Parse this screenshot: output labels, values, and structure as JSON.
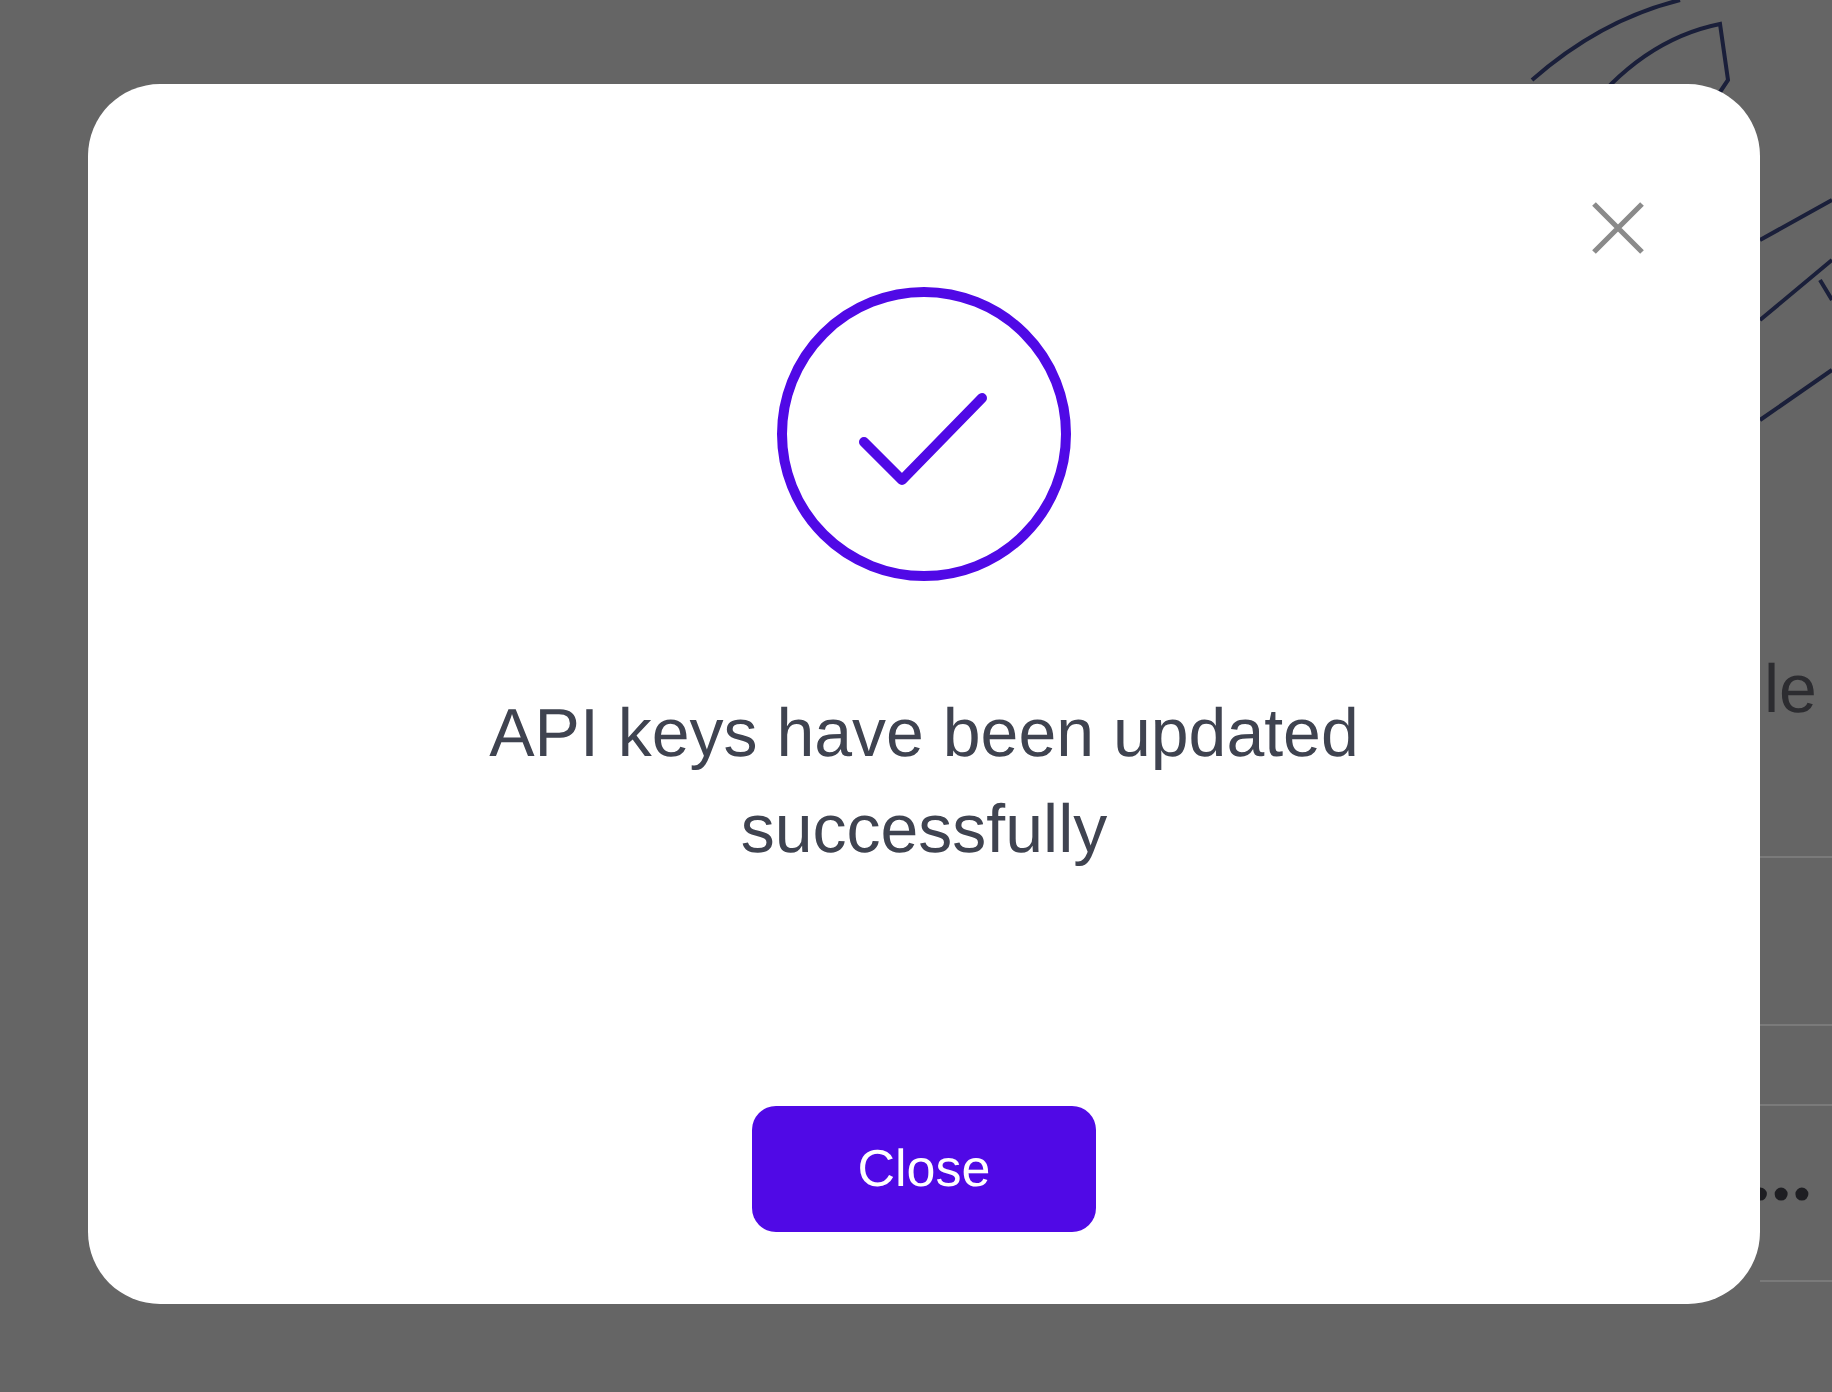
{
  "background": {
    "heading_fragment": "le",
    "password_mask": "•••"
  },
  "dialog": {
    "message": "API keys have been updated successfully",
    "buttons": [
      {
        "label": "Close",
        "kind": "primary"
      }
    ]
  }
}
